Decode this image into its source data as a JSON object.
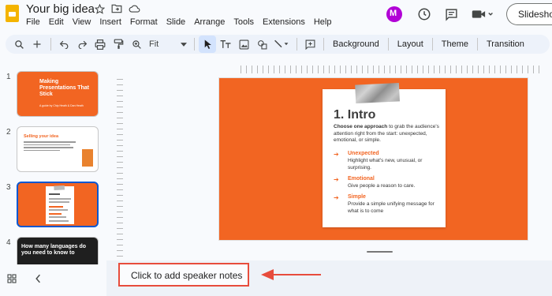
{
  "header": {
    "title": "Your big idea",
    "menu": [
      "File",
      "Edit",
      "View",
      "Insert",
      "Format",
      "Slide",
      "Arrange",
      "Tools",
      "Extensions",
      "Help"
    ],
    "slideshow_label": "Slideshow",
    "icons": [
      "star-icon",
      "move-to-folder-icon",
      "cloud-saved-icon",
      "maker-extension-icon",
      "history-icon",
      "comments-icon",
      "meet-icon"
    ]
  },
  "toolbar": {
    "zoom": "Fit",
    "buttons": [
      "Background",
      "Layout",
      "Theme",
      "Transition"
    ]
  },
  "filmstrip": {
    "slides": [
      {
        "number": "1",
        "title": "Making Presentations That Stick",
        "subtitle": "A guide by Chip Heath & Dan Heath"
      },
      {
        "number": "2",
        "title": "Selling your idea"
      },
      {
        "number": "3",
        "title": "1. Intro"
      },
      {
        "number": "4",
        "title": "How many languages do you need to know to"
      }
    ]
  },
  "slide": {
    "title": "1. Intro",
    "lead_bold": "Choose one approach",
    "lead_rest": " to grab the audience's attention right from the start: unexpected, emotional, or simple.",
    "points": [
      {
        "heading": "Unexpected",
        "desc": "Highlight what's new, unusual, or surprising."
      },
      {
        "heading": "Emotional",
        "desc": "Give people a reason to care."
      },
      {
        "heading": "Simple",
        "desc": "Provide a simple unifying message for what is to come"
      }
    ]
  },
  "notes": {
    "placeholder": "Click to add speaker notes"
  },
  "colors": {
    "accent": "#f26522",
    "annotation": "#e74c3c",
    "selection": "#0b57d0"
  }
}
